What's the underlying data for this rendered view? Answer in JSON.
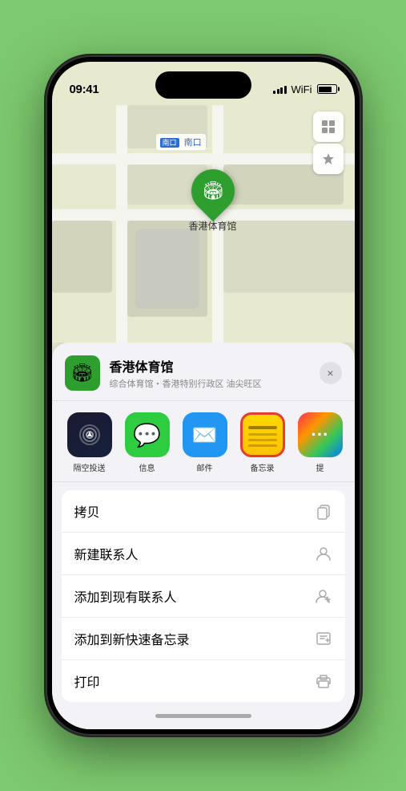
{
  "status": {
    "time": "09:41",
    "time_arrow": "▶"
  },
  "map": {
    "south_gate_label": "南口",
    "south_gate_prefix": "南口",
    "venue_pin_label": "香港体育馆"
  },
  "sheet": {
    "venue_name": "香港体育馆",
    "venue_desc": "综合体育馆・香港特别行政区 油尖旺区",
    "close_label": "×"
  },
  "apps": [
    {
      "id": "airdrop",
      "label": "隔空投送"
    },
    {
      "id": "messages",
      "label": "信息"
    },
    {
      "id": "mail",
      "label": "邮件"
    },
    {
      "id": "notes",
      "label": "备忘录"
    }
  ],
  "actions": [
    {
      "label": "拷贝",
      "icon": "copy"
    },
    {
      "label": "新建联系人",
      "icon": "person"
    },
    {
      "label": "添加到现有联系人",
      "icon": "person-add"
    },
    {
      "label": "添加到新快速备忘录",
      "icon": "memo"
    },
    {
      "label": "打印",
      "icon": "print"
    }
  ]
}
